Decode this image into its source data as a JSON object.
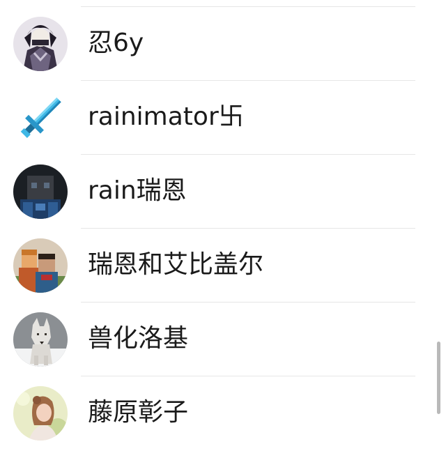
{
  "contacts": [
    {
      "name": "忍6y",
      "avatar_icon": "masked-anime-character-avatar"
    },
    {
      "name": "rainimator卐",
      "avatar_icon": "diamond-sword-icon"
    },
    {
      "name": "rain瑞恩",
      "avatar_icon": "blue-armored-character-avatar"
    },
    {
      "name": "瑞恩和艾比盖尔",
      "avatar_icon": "minecraft-duo-avatar"
    },
    {
      "name": "兽化洛基",
      "avatar_icon": "white-wolf-avatar"
    },
    {
      "name": "藤原彰子",
      "avatar_icon": "girl-portrait-avatar"
    }
  ],
  "colors": {
    "text": "#1a1a1a",
    "divider": "#e6e6e6",
    "scrollbar": "#b9b9b9",
    "background": "#ffffff"
  }
}
